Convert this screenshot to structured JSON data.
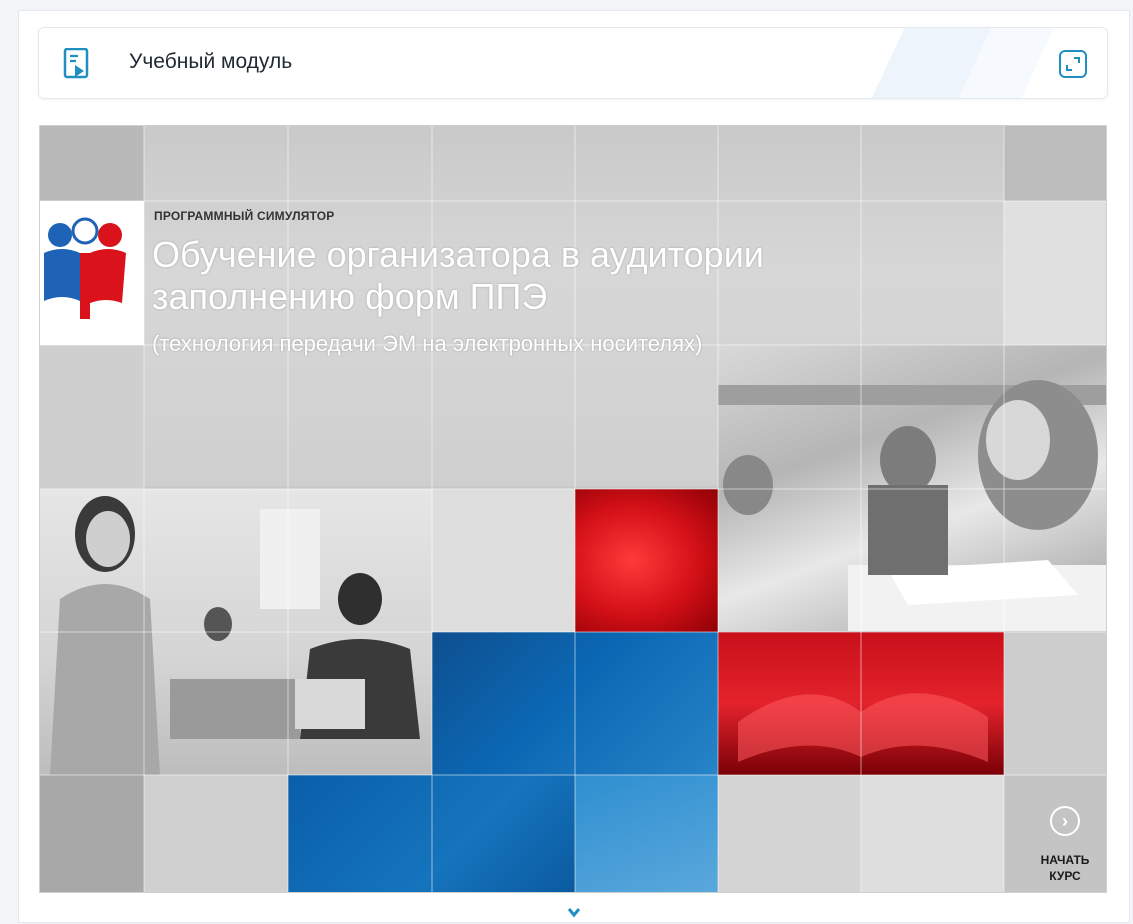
{
  "header": {
    "title": "Учебный модуль",
    "module_icon": "slides-play-icon",
    "expand_icon": "expand-icon"
  },
  "course": {
    "eyebrow": "ПРОГРАММНЫЙ СИМУЛЯТОР",
    "title_line1": "Обучение организатора в аудитории",
    "title_line2": "заполнению форм ППЭ",
    "subtitle": "(технология передачи ЭМ на электронных носителях)",
    "start_line1": "НАЧАТЬ",
    "start_line2": "КУРС",
    "start_icon": "chevron-right-circle-icon",
    "logo": "rustest-logo"
  },
  "colors": {
    "accent": "#1f8fc2",
    "red": "#d9121b",
    "blue": "#0a67b0"
  },
  "scroll_hint_icon": "chevron-down-icon"
}
